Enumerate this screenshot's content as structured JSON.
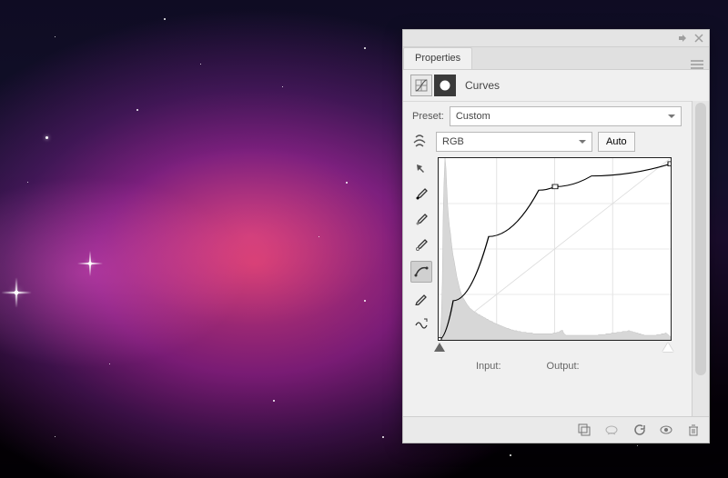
{
  "panel": {
    "tab_label": "Properties",
    "adjustment_name": "Curves",
    "preset_label": "Preset:",
    "preset_value": "Custom",
    "channel_value": "RGB",
    "auto_label": "Auto",
    "input_label": "Input:",
    "output_label": "Output:",
    "input_value": "",
    "output_value": ""
  },
  "tools": [
    "targeted-adjustment-tool",
    "black-point-eyedropper",
    "gray-point-eyedropper",
    "white-point-eyedropper",
    "curve-edit-tool",
    "pencil-tool",
    "smooth-tool"
  ],
  "footer_icons": [
    "clip-to-layer",
    "view-previous",
    "reset",
    "visibility",
    "delete"
  ],
  "chart_data": {
    "type": "line",
    "title": "Curves",
    "xlabel": "Input",
    "ylabel": "Output",
    "xlim": [
      0,
      255
    ],
    "ylim": [
      0,
      255
    ],
    "series": [
      {
        "name": "curve",
        "points": [
          [
            0,
            0
          ],
          [
            16,
            55
          ],
          [
            55,
            145
          ],
          [
            110,
            210
          ],
          [
            128,
            215
          ],
          [
            168,
            230
          ],
          [
            255,
            247
          ]
        ]
      }
    ],
    "control_points": [
      [
        0,
        0
      ],
      [
        128,
        215
      ],
      [
        255,
        247
      ]
    ],
    "histogram": [
      0,
      3,
      10,
      30,
      75,
      165,
      210,
      238,
      226,
      200,
      175,
      160,
      148,
      140,
      128,
      118,
      110,
      104,
      97,
      90,
      83,
      78,
      73,
      68,
      64,
      60,
      57,
      55,
      53,
      51,
      49,
      47,
      45,
      44,
      42,
      41,
      40,
      39,
      38,
      37,
      36,
      36,
      35,
      34,
      33,
      33,
      32,
      31,
      31,
      30,
      29,
      29,
      28,
      27,
      27,
      26,
      25,
      25,
      24,
      24,
      23,
      22,
      22,
      21,
      21,
      20,
      20,
      19,
      19,
      18,
      18,
      17,
      17,
      16,
      16,
      15,
      15,
      15,
      14,
      14,
      13,
      13,
      13,
      12,
      12,
      12,
      12,
      11,
      11,
      11,
      11,
      10,
      10,
      10,
      10,
      10,
      10,
      9,
      9,
      9,
      9,
      9,
      9,
      9,
      8,
      8,
      8,
      8,
      8,
      8,
      8,
      8,
      8,
      8,
      8,
      8,
      8,
      8,
      8,
      8,
      8,
      8,
      8,
      8,
      8,
      8,
      9,
      9,
      9,
      9,
      10,
      10,
      10,
      11,
      12,
      12,
      13,
      10,
      8,
      7,
      6,
      6,
      6,
      6,
      6,
      6,
      6,
      6,
      6,
      6,
      6,
      6,
      6,
      6,
      6,
      6,
      6,
      6,
      6,
      6,
      6,
      6,
      6,
      6,
      6,
      6,
      6,
      6,
      6,
      6,
      6,
      6,
      6,
      6,
      6,
      6,
      7,
      7,
      7,
      7,
      7,
      7,
      7,
      7,
      8,
      8,
      8,
      8,
      8,
      8,
      9,
      9,
      9,
      9,
      9,
      9,
      10,
      10,
      10,
      10,
      10,
      10,
      11,
      11,
      11,
      11,
      11,
      11,
      12,
      12,
      12,
      11,
      11,
      11,
      10,
      10,
      10,
      9,
      9,
      9,
      8,
      8,
      8,
      7,
      7,
      7,
      6,
      6,
      6,
      6,
      6,
      6,
      6,
      6,
      6,
      6,
      6,
      6,
      6,
      6,
      7,
      7,
      7,
      7,
      7,
      8,
      8,
      8,
      8,
      9,
      9,
      8,
      7,
      6,
      5,
      4
    ]
  }
}
